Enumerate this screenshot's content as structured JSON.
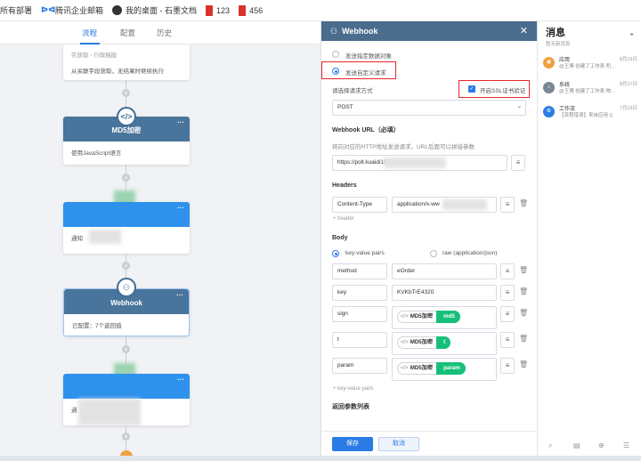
{
  "bookmarks": [
    {
      "label": "所有部署",
      "icon": "none"
    },
    {
      "label": "腾讯企业邮箱",
      "icon": "tencent-mail-icon"
    },
    {
      "label": "我的桌面 - 石墨文档",
      "icon": "shimo-icon"
    },
    {
      "label": "123",
      "icon": "bookmark-red-icon"
    },
    {
      "label": "456",
      "icon": "bookmark-red-icon"
    }
  ],
  "canvas": {
    "tabs": [
      "流程",
      "配置",
      "历史"
    ],
    "active_tab": 0,
    "top_node": {
      "title": "实获取 - 行政稿版",
      "desc": "从关联字段获取，无结果时继续执行"
    },
    "md5_node": {
      "title": "MD5加密",
      "desc": "使用JavaScript语言"
    },
    "webhook_node": {
      "title": "Webhook",
      "desc": "已配置：7个返回值"
    },
    "blue_node_1": {
      "desc": "通知"
    },
    "blue_node_2": {
      "desc": "通"
    },
    "more_glyph": "···",
    "plus_glyph": "+"
  },
  "drawer": {
    "title": "Webhook",
    "close": "✕",
    "radio_specific": "发送指定数据对象",
    "radio_custom": "发送自定义请求",
    "method_label": "请选择请求方式",
    "ssl_label": "开启SSL证书验证",
    "method_value": "POST",
    "url_label": "Webhook URL（必填）",
    "url_hint": "将向对应的HTTP地址发送请求，URL后面可以拼接参数",
    "url_value": "https://poll.kuaidi100.",
    "headers_label": "Headers",
    "header_key": "Content-Type",
    "header_value": "application/x-ww",
    "add_header": "+ header",
    "body_label": "Body",
    "body_kv": "key-value pairs",
    "body_raw": "raw (application/json)",
    "rows": [
      {
        "key": "method",
        "value": "eOrder"
      },
      {
        "key": "key",
        "value": "KVKbTrE4320"
      },
      {
        "key": "sign",
        "pill": "MD5加密",
        "tag": "md5"
      },
      {
        "key": "t",
        "pill": "MD5加密",
        "tag": "t"
      },
      {
        "key": "param",
        "pill": "MD5加密",
        "tag": "param"
      }
    ],
    "add_kv": "+ key-value pairs",
    "return_label": "返回参数列表",
    "save": "保存",
    "cancel": "取消",
    "dropdown_glyph": "⌄",
    "field_btn_glyph": "≡",
    "trash_glyph": "🗑"
  },
  "messages": {
    "title": "消息",
    "subtitle": "暂无新消息",
    "items": [
      {
        "name": "应用",
        "time": "8月19日",
        "text": "@王博 创建了工作表 积...",
        "color": "#f0a040",
        "icon": "app-icon"
      },
      {
        "name": "系统",
        "time": "8月17日",
        "text": "@王博 创建了工作表 物...",
        "color": "#7a8794",
        "icon": "bell-icon"
      },
      {
        "name": "工作流",
        "time": "7月13日",
        "text": "【流程错误】来自应用 ((",
        "color": "#2b7be6",
        "icon": "workflow-icon"
      }
    ]
  }
}
